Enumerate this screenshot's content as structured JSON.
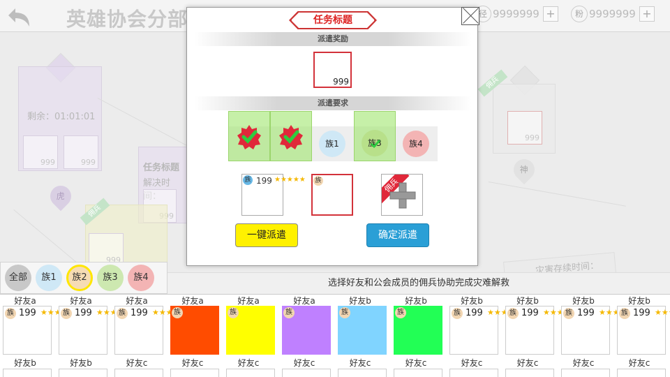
{
  "scene": {
    "title": "英雄协会分部",
    "currencies": [
      {
        "icon_text": "径",
        "value": "9999999"
      },
      {
        "icon_text": "粉",
        "value": "9999999"
      }
    ],
    "plus_label": "+",
    "remaining_text": "剩余：01:01:01",
    "task_title_ghost": "任务标题",
    "resolve_time_ghost": "解决时间：",
    "disaster_time_ghost": "灾害存续时间：",
    "ghost_values": [
      "999",
      "999",
      "999",
      "999"
    ],
    "ghost_bonus": "额外",
    "pins": [
      "虎",
      "虎",
      "神"
    ],
    "banners": [
      "佣兵",
      "佣兵"
    ]
  },
  "dialog": {
    "title": "任务标题",
    "reward_header": "派遣奖励",
    "reward_value": "999",
    "requirement_header": "派遣要求",
    "clan_requirements": [
      {
        "label": "族1",
        "color": "#cfe8f6"
      },
      {
        "label": "族3",
        "color": "#b8e08a"
      },
      {
        "label": "族4",
        "color": "#f3b4b4"
      }
    ],
    "slots": [
      {
        "tag": "族",
        "level": "199",
        "stars": "★★★★★"
      },
      {
        "tag": "族"
      },
      {
        "banner": "佣兵"
      }
    ],
    "auto_dispatch_label": "一键派遣",
    "confirm_dispatch_label": "确定派遣"
  },
  "filters": [
    {
      "label": "全部",
      "color": "#c8c8c8"
    },
    {
      "label": "族1",
      "color": "#cfe8f6"
    },
    {
      "label": "族2",
      "color": "#f6dcb4"
    },
    {
      "label": "族3",
      "color": "#cde8b0"
    },
    {
      "label": "族4",
      "color": "#f3b4b4"
    }
  ],
  "hint": "选择好友和公会成员的佣兵协助完成灾难解救",
  "friends": [
    {
      "name": "好友a",
      "tag": "族",
      "level": "199",
      "stars": "★★★★★",
      "color": "#ffffff",
      "name2": "好友b"
    },
    {
      "name": "好友a",
      "tag": "族",
      "level": "199",
      "stars": "★★★★★",
      "color": "#ffffff",
      "name2": "好友b"
    },
    {
      "name": "好友a",
      "tag": "族",
      "level": "199",
      "stars": "★★★★★",
      "color": "#ffffff",
      "name2": "好友c"
    },
    {
      "name": "好友a",
      "tag": "族",
      "level": "",
      "stars": "",
      "color": "#ff4c00",
      "name2": "好友c"
    },
    {
      "name": "好友a",
      "tag": "族",
      "level": "",
      "stars": "",
      "color": "#ffff00",
      "name2": "好友c"
    },
    {
      "name": "好友a",
      "tag": "族",
      "level": "",
      "stars": "",
      "color": "#bf80ff",
      "name2": "好友c"
    },
    {
      "name": "好友b",
      "tag": "族",
      "level": "",
      "stars": "",
      "color": "#80d4ff",
      "name2": "好友c"
    },
    {
      "name": "好友b",
      "tag": "族",
      "level": "",
      "stars": "",
      "color": "#22ff55",
      "name2": "好友c"
    },
    {
      "name": "好友b",
      "tag": "族",
      "level": "199",
      "stars": "★★★★★",
      "color": "#ffffff",
      "name2": "好友c"
    },
    {
      "name": "好友b",
      "tag": "族",
      "level": "199",
      "stars": "★★★★★",
      "color": "#ffffff",
      "name2": "好友c"
    },
    {
      "name": "好友b",
      "tag": "族",
      "level": "199",
      "stars": "★★★★★",
      "color": "#ffffff",
      "name2": "好友c"
    },
    {
      "name": "好友b",
      "tag": "族",
      "level": "199",
      "stars": "★★★★★",
      "color": "#ffffff",
      "name2": "好友c"
    }
  ]
}
